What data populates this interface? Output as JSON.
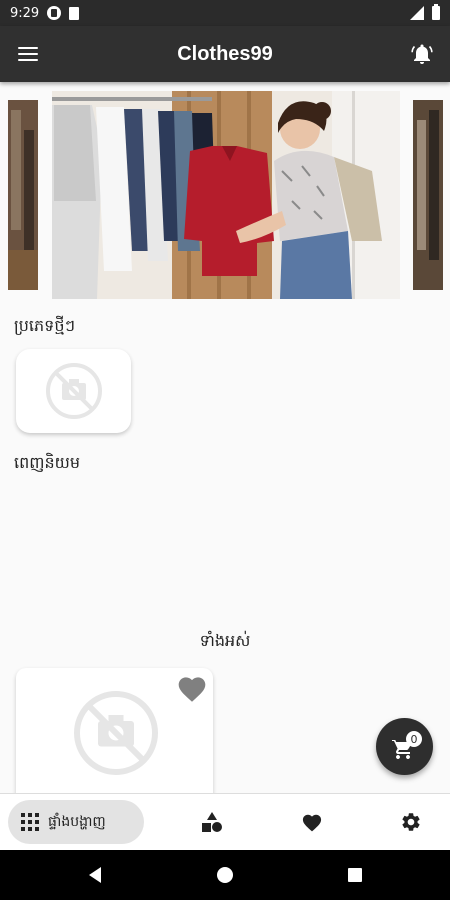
{
  "status_bar": {
    "time": "9:29"
  },
  "app_bar": {
    "title": "Clothes99",
    "menu_icon": "hamburger-menu-icon",
    "notification_icon": "bell-icon"
  },
  "carousel": {
    "image_description_icon": "clothing-store-photo"
  },
  "sections": {
    "new_types": "ប្រភេទថ្មីៗ",
    "popular": "ពេញនិយម",
    "all": "ទាំងអស់"
  },
  "cart": {
    "count": "0"
  },
  "bottom_nav": {
    "home_label": "ផ្ទាំងបង្ហាញ",
    "home_icon": "grid-icon",
    "categories_icon": "shapes-icon",
    "favorites_icon": "heart-icon",
    "settings_icon": "gear-icon"
  },
  "colors": {
    "app_bar": "#303030",
    "background": "#fafafa",
    "fab": "#2e2e2e",
    "icon_gray": "#888888"
  }
}
